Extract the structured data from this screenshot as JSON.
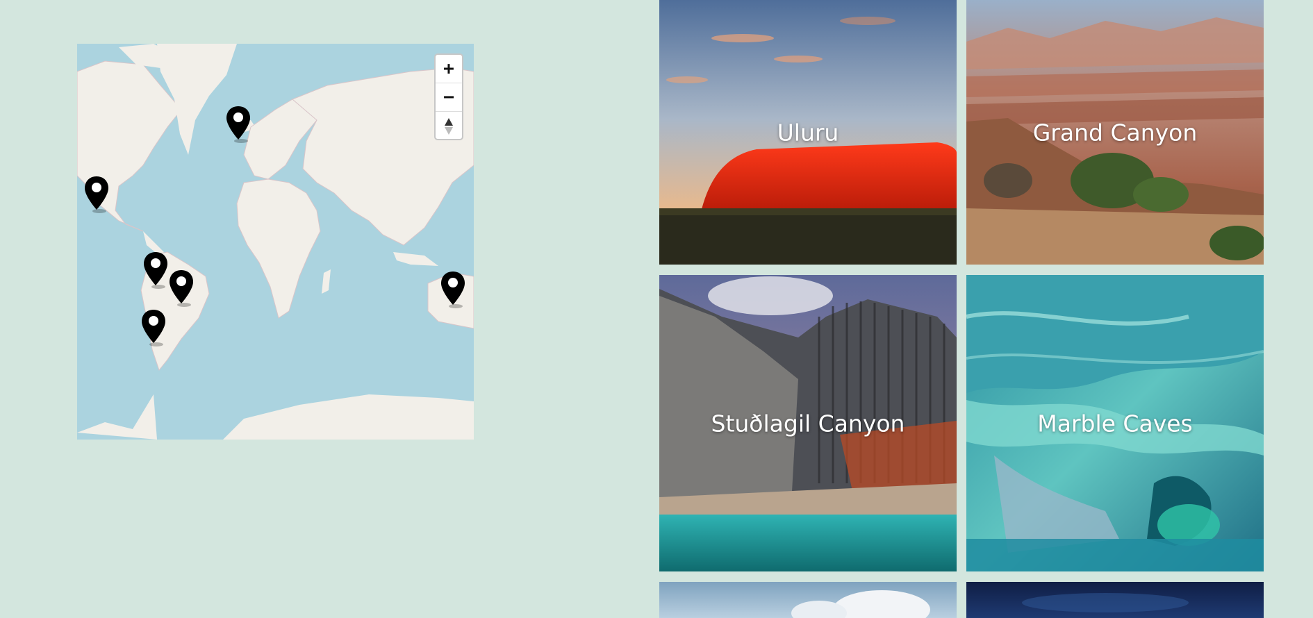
{
  "map": {
    "zoom_in_label": "+",
    "zoom_out_label": "−",
    "markers": [
      "iceland",
      "california",
      "peru",
      "brazil",
      "chile",
      "australia"
    ]
  },
  "gallery": {
    "cards": [
      {
        "label": "Uluru"
      },
      {
        "label": "Grand Canyon"
      },
      {
        "label": "Stuðlagil Canyon"
      },
      {
        "label": "Marble Caves"
      },
      {
        "label": ""
      },
      {
        "label": ""
      }
    ]
  },
  "colors": {
    "background": "#d3e6de",
    "ocean": "#abd3df",
    "land": "#f2efe9"
  }
}
